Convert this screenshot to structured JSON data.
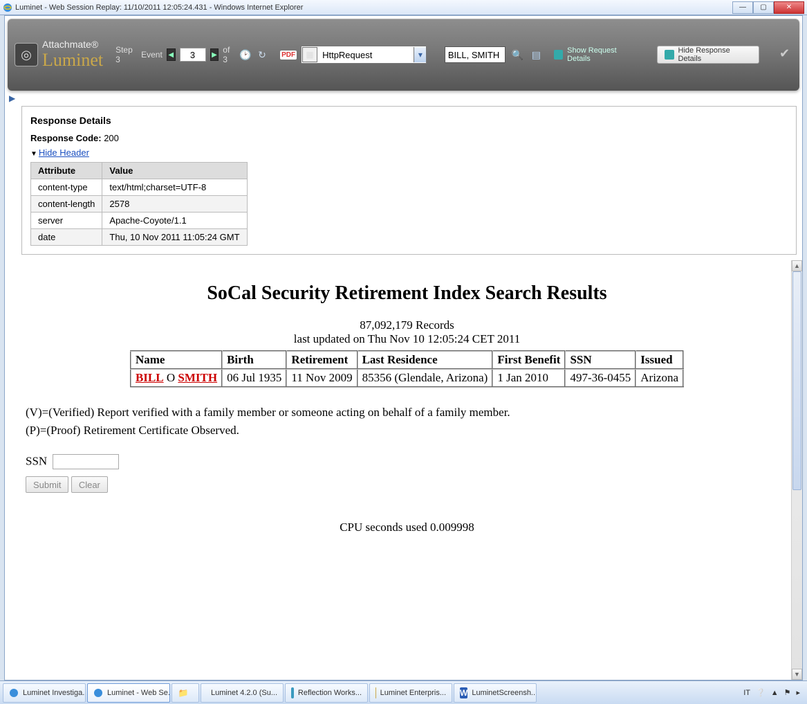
{
  "window": {
    "title": "Luminet - Web Session Replay: 11/10/2011 12:05:24.431 - Windows Internet Explorer"
  },
  "brand": {
    "line1": "Attachmate",
    "line2": "Luminet",
    "reg": "®"
  },
  "toolbar": {
    "step_label": "Step 3",
    "event_label": "Event",
    "event_value": "3",
    "of_label": "of 3",
    "http_select": "HttpRequest",
    "search_value": "BILL, SMITH",
    "show_req_label": "Show Request Details",
    "hide_resp_label": "Hide Response Details"
  },
  "response": {
    "panel_title": "Response Details",
    "code_label": "Response Code:",
    "code_value": "200",
    "hide_header": "Hide Header",
    "cols": {
      "attr": "Attribute",
      "val": "Value"
    },
    "rows": [
      {
        "attr": "content-type",
        "val": "text/html;charset=UTF-8"
      },
      {
        "attr": "content-length",
        "val": "2578"
      },
      {
        "attr": "server",
        "val": "Apache-Coyote/1.1"
      },
      {
        "attr": "date",
        "val": "Thu, 10 Nov 2011 11:05:24 GMT"
      }
    ]
  },
  "page": {
    "heading": "SoCal Security Retirement Index Search Results",
    "record_count": "87,092,179 Records",
    "updated": "last updated on Thu Nov 10 12:05:24 CET 2011",
    "cols": [
      "Name",
      "Birth",
      "Retirement",
      "Last Residence",
      "First Benefit",
      "SSN",
      "Issued"
    ],
    "row": {
      "first": "BILL",
      "middle": "O",
      "last": "SMITH",
      "birth": "06 Jul 1935",
      "retirement": "11 Nov 2009",
      "residence": "85356 (Glendale, Arizona)",
      "first_benefit": "1 Jan 2010",
      "ssn": "497-36-0455",
      "issued": "Arizona"
    },
    "legend_v": "(V)=(Verified) Report verified with a family member or someone acting on behalf of a family member.",
    "legend_p": "(P)=(Proof) Retirement Certificate Observed.",
    "ssn_label": "SSN",
    "submit": "Submit",
    "clear": "Clear",
    "cpu": "CPU seconds used 0.009998"
  },
  "taskbar": {
    "items": [
      "Luminet Investiga...",
      "Luminet - Web Se...",
      "",
      "Luminet 4.2.0 (Su...",
      "Reflection Works...",
      "Luminet Enterpris...",
      "LuminetScreensh..."
    ],
    "lang": "IT"
  }
}
